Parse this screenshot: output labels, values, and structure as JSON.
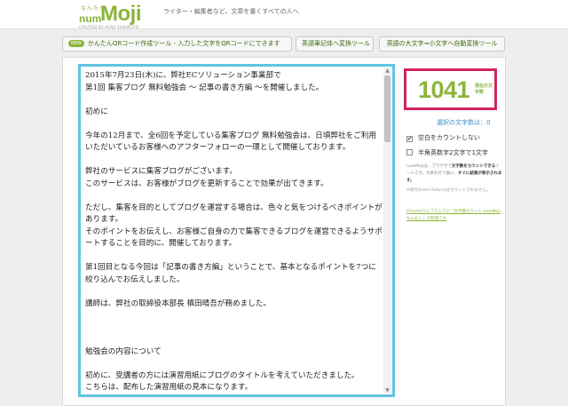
{
  "header": {
    "logo_small": "なんたん",
    "logo_num": "num",
    "logo_moji": "Moji",
    "logo_credit": "CREATED BY KENJI SUGIMOTO",
    "tagline": "ライター・編集者など、文章を書くすべての人へ"
  },
  "toolbar": {
    "new_badge": "NEW",
    "qr_tool": "かんたんQRコード作成ツール - 入力した文字をQRコードにできます",
    "eng_tool": "英語筆記体へ変換ツール",
    "case_tool": "英語の大文字⇒小文字へ自動変換ツール"
  },
  "editor": {
    "paragraphs": [
      "2015年7月23日(木)に、弊社ECソリューション事業部で\n第1回 集客ブログ 無料勉強会 〜 記事の書き方編 〜を開催しました。",
      "初めに",
      "今年の12月まで、全6回を予定している集客ブログ 無料勉強会は、日頃弊社をご利用いただいているお客様へのアフターフォローの一環として開催しております。",
      "弊社のサービスに集客ブログがございます。\nこのサービスは、お客様がブログを更新することで効果が出てきます。",
      "ただし、集客を目的としてブログを運営する場合は、色々と気をつけるべきポイントがあります。\nそのポイントをお伝えし、お客様ご自身の力で集客できるブログを運営できるようサポートすることを目的に、開催しております。",
      "第1回目となる今回は「記事の書き方編」ということで、基本となるポイントを7つに絞り込んでお伝えしました。",
      "講師は、弊社の取締役本部長 槙田晴吾が務めました。",
      "",
      "勉強会の内容について",
      "初めに、受講者の方には演習用紙にブログのタイトルを考えていただきました。\nこちらは、配布した演習用紙の見本になります。"
    ]
  },
  "counter": {
    "value": "1041",
    "label": "現在の文字数"
  },
  "options": {
    "selection_count": "選択の文字数は：0",
    "ignore_space_label": "空白をカウントしない",
    "ignore_space_checked": true,
    "halfwidth_label": "半角英数字2文字で1文字",
    "halfwidth_checked": false
  },
  "notes": {
    "desc_prefix": "numMojiは、ブラウザで",
    "desc_bold1": "文字数をカウントできる",
    "desc_mid": "ツールです。文章を打つ後に、",
    "desc_bold2": "すぐに結果が表示されます。",
    "desc_small": "※改行(Enter Return)はカウントされません。",
    "chrome_link": "Chromeウェブストアに「文字数カウント numMojiなんもじ」が登場です"
  },
  "colors": {
    "brand_green": "#8bb43a",
    "editor_border": "#5fc4e0",
    "counter_border": "#d0245a",
    "link_blue": "#3b8fc7"
  }
}
